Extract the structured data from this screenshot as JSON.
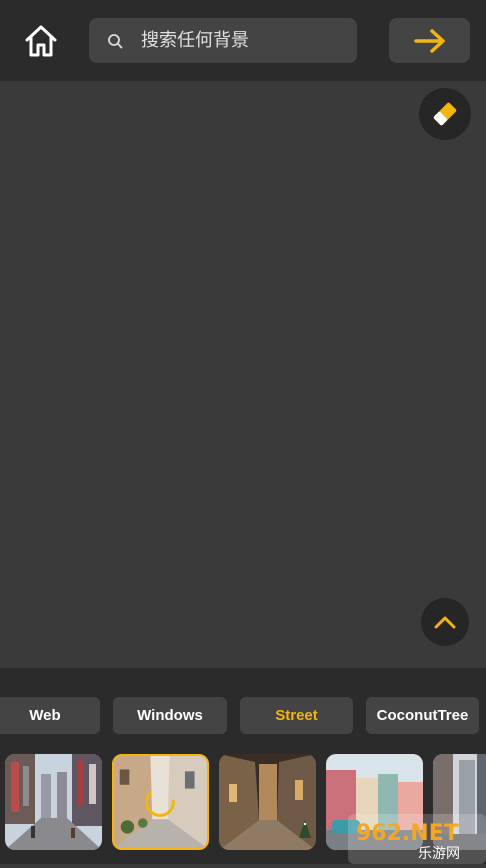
{
  "search": {
    "placeholder": "搜索任何背景",
    "value": ""
  },
  "colors": {
    "accent": "#f5b50f",
    "panel": "#2b2b2b",
    "canvas": "#3a3a3a",
    "control": "#444444"
  },
  "icons": {
    "home": "home-icon",
    "search": "search-icon",
    "go": "arrow-right-icon",
    "eraser": "eraser-icon",
    "expand": "chevron-up-icon"
  },
  "categories": [
    {
      "label": "Web",
      "active": false
    },
    {
      "label": "Windows",
      "active": false
    },
    {
      "label": "Street",
      "active": true
    },
    {
      "label": "CoconutTree",
      "active": false
    }
  ],
  "thumbnails": [
    {
      "name": "city-street",
      "selected": false
    },
    {
      "name": "stone-alley",
      "selected": true
    },
    {
      "name": "night-lane",
      "selected": false
    },
    {
      "name": "havana-street",
      "selected": false
    },
    {
      "name": "skyscraper-street",
      "selected": false
    }
  ],
  "watermark": {
    "line1": "962.NET",
    "line2": "乐游网"
  }
}
